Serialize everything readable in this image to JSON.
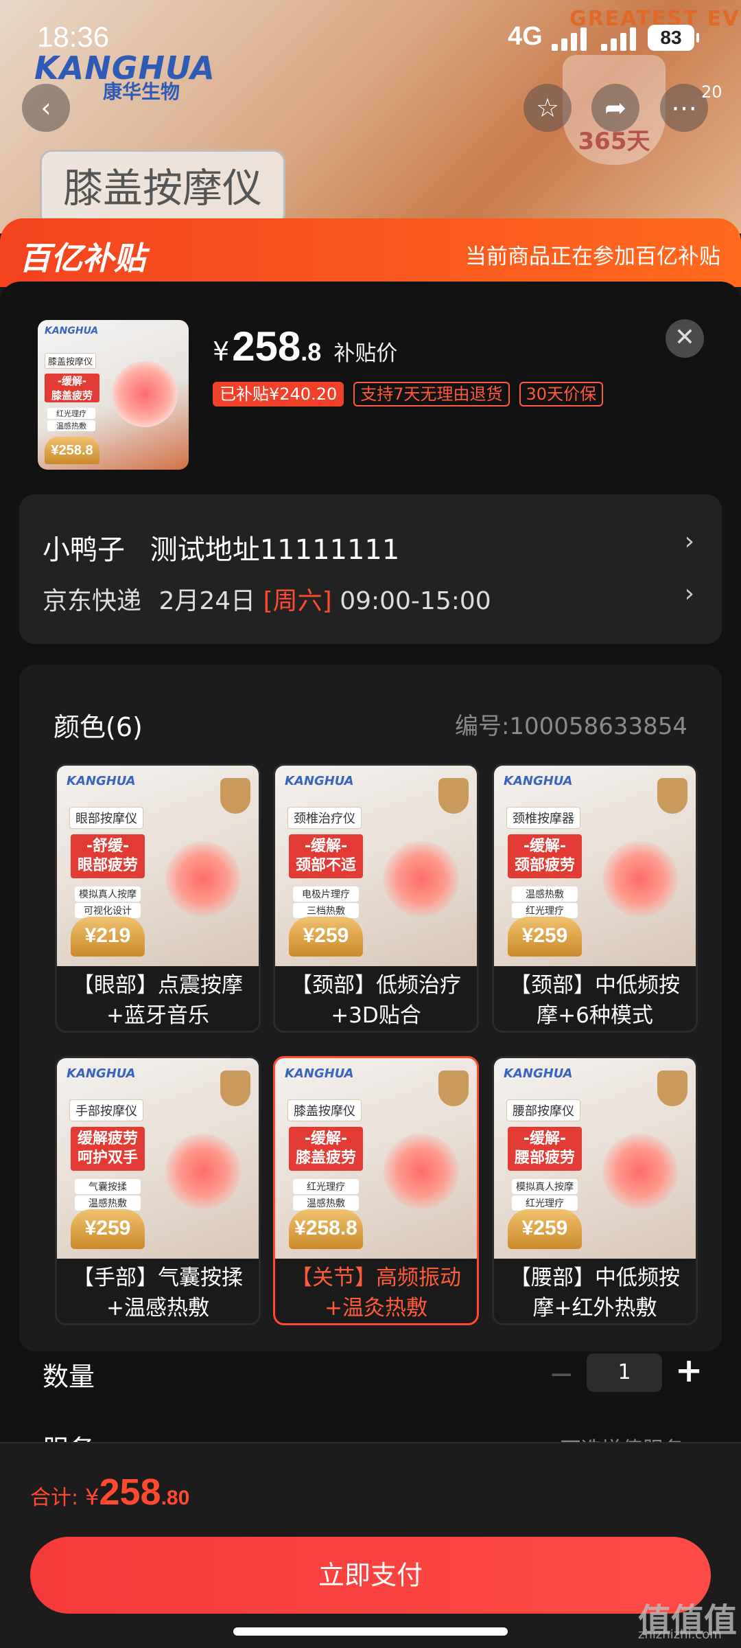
{
  "status_bar": {
    "time": "18:36",
    "network": "4G",
    "battery": "83"
  },
  "background": {
    "brand": "KANGHUA",
    "brand_cn": "康华生物",
    "product_tag": "膝盖按摩仪",
    "banner": "GREATEST EV",
    "seal_text": "365天",
    "badge_count": "20"
  },
  "subsidy": {
    "logo": "百亿补贴",
    "text": "当前商品正在参加百亿补贴"
  },
  "product": {
    "price_symbol": "¥",
    "price_int": "258",
    "price_dec": ".8",
    "price_label": "补贴价",
    "tags": [
      "已补贴¥240.20",
      "支持7天无理由退货",
      "30天价保"
    ],
    "thumb": {
      "category": "膝盖按摩仪",
      "headline": "-缓解-\n膝盖疲劳",
      "features": [
        "红光理疗",
        "温感热敷"
      ],
      "price": "¥258.8"
    }
  },
  "address": {
    "name": "小鸭子",
    "address": "测试地址11111111",
    "carrier": "京东快递",
    "date": "2月24日",
    "weekday": "[周六]",
    "time_window": "09:00-15:00"
  },
  "options": {
    "title": "颜色(6)",
    "sku": "编号:100058633854",
    "items": [
      {
        "name": "【眼部】点震按摩+蓝牙音乐",
        "category": "眼部按摩仪",
        "headline": "-舒缓-\n眼部疲劳",
        "features": [
          "模拟真人按摩",
          "可视化设计"
        ],
        "price": "¥219",
        "selected": false
      },
      {
        "name": "【颈部】低频治疗+3D贴合",
        "category": "颈椎治疗仪",
        "headline": "-缓解-\n颈部不适",
        "features": [
          "电极片理疗",
          "三档热敷"
        ],
        "price": "¥259",
        "selected": false
      },
      {
        "name": "【颈部】中低频按摩+6种模式",
        "category": "颈椎按摩器",
        "headline": "-缓解-\n颈部疲劳",
        "features": [
          "温感热敷",
          "红光理疗"
        ],
        "price": "¥259",
        "selected": false
      },
      {
        "name": "【手部】气囊按揉+温感热敷",
        "category": "手部按摩仪",
        "headline": "缓解疲劳\n呵护双手",
        "features": [
          "气囊按揉",
          "温感热敷"
        ],
        "price": "¥259",
        "selected": false
      },
      {
        "name": "【关节】高频振动+温灸热敷",
        "category": "膝盖按摩仪",
        "headline": "-缓解-\n膝盖疲劳",
        "features": [
          "红光理疗",
          "温感热敷"
        ],
        "price": "¥258.8",
        "selected": true
      },
      {
        "name": "【腰部】中低频按摩+红外热敷",
        "category": "腰部按摩仪",
        "headline": "-缓解-\n腰部疲劳",
        "features": [
          "模拟真人按摩",
          "红光理疗"
        ],
        "price": "¥259",
        "selected": false
      }
    ]
  },
  "quantity": {
    "label": "数量",
    "minus": "−",
    "value": "1",
    "plus": "+"
  },
  "service": {
    "label": "服务",
    "value": "可选增值服务 ›"
  },
  "footer": {
    "total_label": "合计:",
    "symbol": "¥",
    "total_int": "258",
    "total_dec": ".80",
    "pay_label": "立即支付"
  },
  "watermark": {
    "main": "值值值",
    "sub": "zhizhizhi.com"
  },
  "colors": {
    "accent": "#ff4a30",
    "subsidy_start": "#f3431f",
    "subsidy_end": "#ff6a1d"
  }
}
